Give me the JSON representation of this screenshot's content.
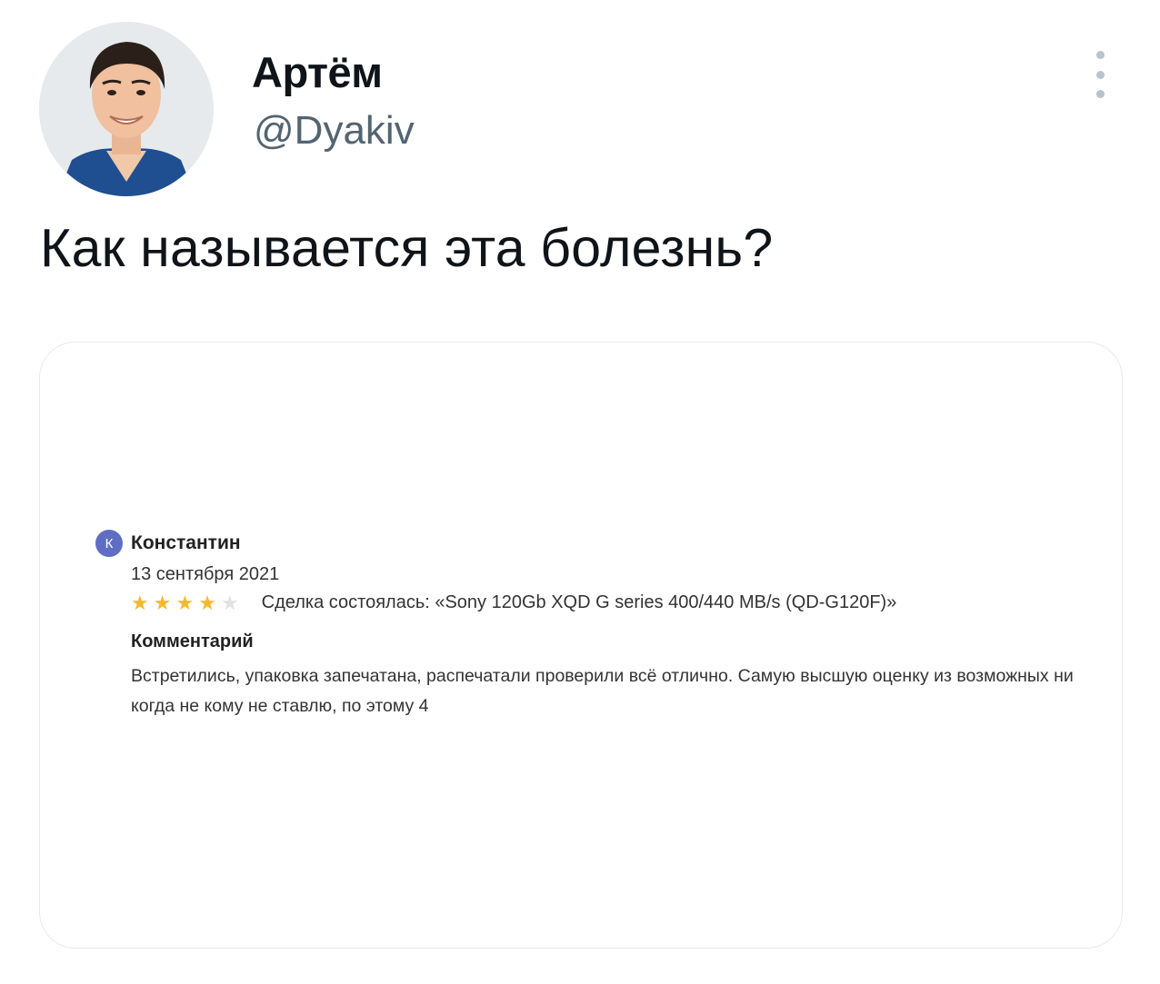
{
  "tweet": {
    "author": {
      "name": "Артём",
      "handle": "@Dyakiv"
    },
    "text": "Как называется эта болезнь?",
    "menu_icon": "more-vertical-icon"
  },
  "review": {
    "avatar_letter": "К",
    "avatar_color": "#5f6ec4",
    "reviewer_name": "Константин",
    "date": "13 сентября 2021",
    "rating": 4,
    "rating_max": 5,
    "star_color": "#f5b82e",
    "deal_text": "Сделка состоялась: «Sony 120Gb XQD G series 400/440 MB/s (QD-G120F)»",
    "comment_heading": "Комментарий",
    "comment_text": "Встретились, упаковка запечатана, распечатали проверили всё отлично. Самую высшую оценку из возможных ни когда не кому не ставлю, по этому 4"
  }
}
